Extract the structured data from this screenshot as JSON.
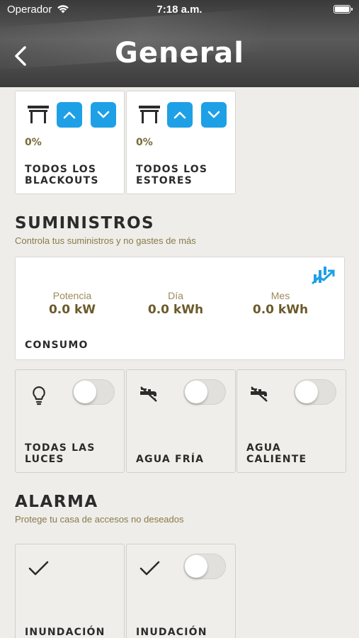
{
  "status_bar": {
    "carrier": "Operador",
    "time": "7:18 a.m."
  },
  "header": {
    "title": "General"
  },
  "blinds": [
    {
      "percent": "0%",
      "label": "TODOS LOS\nBLACKOUTS"
    },
    {
      "percent": "0%",
      "label": "TODOS LOS\nESTORES"
    }
  ],
  "supplies": {
    "title": "SUMINISTROS",
    "subtitle": "Controla tus suministros y no gastes de más",
    "consumption": {
      "label": "CONSUMO",
      "metrics": [
        {
          "label": "Potencia",
          "value": "0.0 kW"
        },
        {
          "label": "Día",
          "value": "0.0 kWh"
        },
        {
          "label": "Mes",
          "value": "0.0 kWh"
        }
      ]
    },
    "toggles": [
      {
        "label": "TODAS LAS\nLUCES",
        "icon": "lightbulb-icon",
        "on": false
      },
      {
        "label": "AGUA FRÍA",
        "icon": "water-tap-off-icon",
        "on": false
      },
      {
        "label": "AGUA\nCALIENTE",
        "icon": "water-tap-off-icon",
        "on": false
      }
    ]
  },
  "alarm": {
    "title": "ALARMA",
    "subtitle": "Protege tu casa de accesos no deseados",
    "items": [
      {
        "label": "INUNDACIÓN",
        "icon": "check-icon"
      },
      {
        "label": "INUDACIÓN",
        "icon": "check-icon",
        "on": false
      }
    ]
  },
  "colors": {
    "accent": "#1ea0e6",
    "gold_text": "#8a7a4a",
    "background": "#eeede9"
  }
}
